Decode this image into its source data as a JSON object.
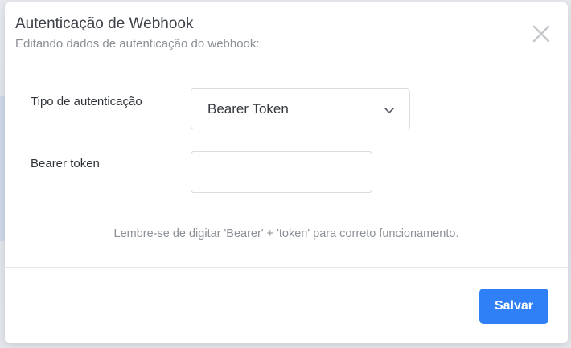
{
  "modal": {
    "title": "Autenticação de Webhook",
    "subtitle": "Editando dados de autenticação do webhook:",
    "close_icon": "close-icon"
  },
  "form": {
    "auth_type_label": "Tipo de autenticação",
    "auth_type_value": "Bearer Token",
    "bearer_token_label": "Bearer token",
    "bearer_token_value": "",
    "bearer_token_placeholder": ""
  },
  "hint": "Lembre-se de digitar 'Bearer' + 'token' para correto funcionamento.",
  "footer": {
    "save_label": "Salvar"
  },
  "colors": {
    "primary": "#2f7ff6",
    "text": "#3d4148",
    "muted": "#8b9097",
    "border": "#d9dce1"
  }
}
